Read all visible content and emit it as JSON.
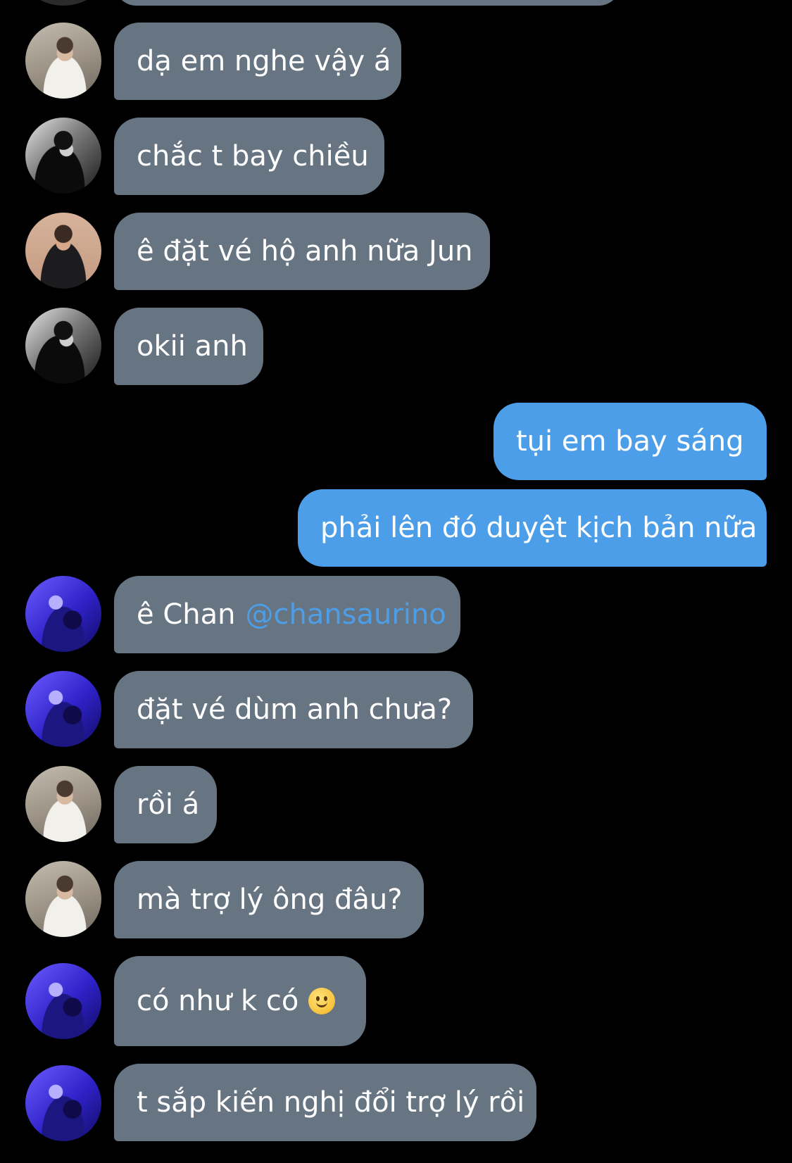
{
  "conversation": {
    "messages": [
      {
        "direction": "in",
        "avatar": "white-shirt",
        "text": "dạ em nghe vậy á"
      },
      {
        "direction": "in",
        "avatar": "leather",
        "text": "chắc t bay chiều"
      },
      {
        "direction": "in",
        "avatar": "suit",
        "text": "ê đặt vé hộ anh nữa Jun"
      },
      {
        "direction": "in",
        "avatar": "leather",
        "text": "okii anh"
      },
      {
        "direction": "out",
        "text": "tụi em bay sáng"
      },
      {
        "direction": "out",
        "text": "phải lên đó duyệt kịch bản nữa"
      },
      {
        "direction": "in",
        "avatar": "blue",
        "text": "ê Chan",
        "mention": "@chansaurino"
      },
      {
        "direction": "in",
        "avatar": "blue",
        "text": "đặt vé dùm anh chưa?"
      },
      {
        "direction": "in",
        "avatar": "white-shirt",
        "text": "rồi á"
      },
      {
        "direction": "in",
        "avatar": "white-shirt",
        "text": "mà trợ lý ông đâu?"
      },
      {
        "direction": "in",
        "avatar": "blue",
        "text": "có như k có",
        "emoji": "slightly-smiling-face-icon"
      },
      {
        "direction": "in",
        "avatar": "blue",
        "text": "t sắp kiến nghị đổi trợ lý rồi"
      }
    ]
  },
  "colors": {
    "background": "#000000",
    "incoming_bubble": "#677482",
    "outgoing_bubble": "#4c9ee8",
    "mention": "#4c9ee8",
    "text": "#ffffff"
  }
}
